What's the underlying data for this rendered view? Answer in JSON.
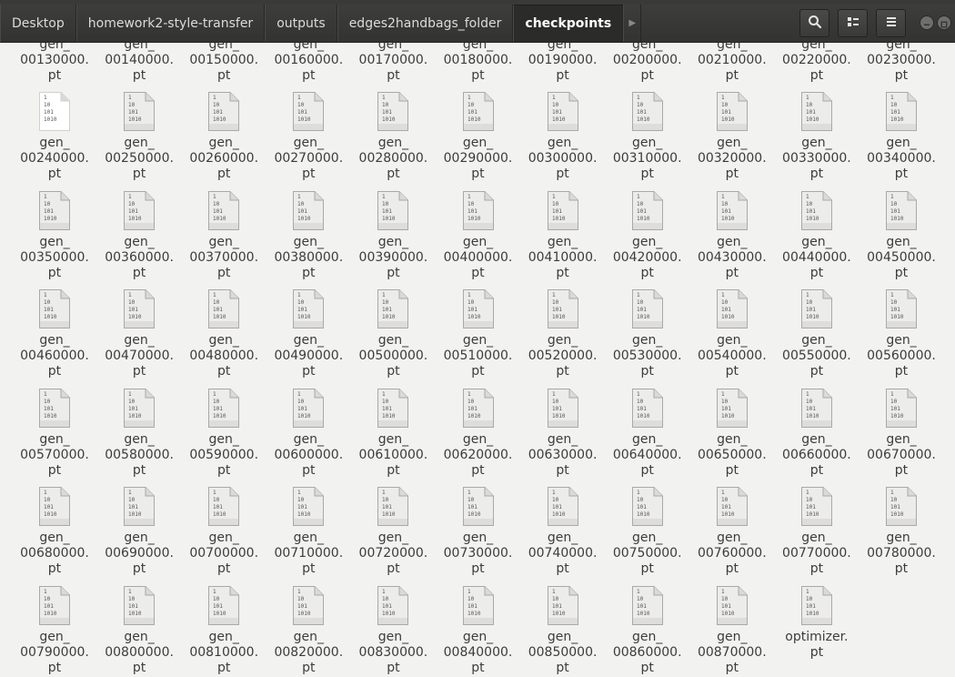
{
  "breadcrumbs": [
    {
      "label": "Desktop",
      "active": false
    },
    {
      "label": "homework2-style-transfer",
      "active": false
    },
    {
      "label": "outputs",
      "active": false
    },
    {
      "label": "edges2handbags_folder",
      "active": false
    },
    {
      "label": "checkpoints",
      "active": true
    }
  ],
  "toolbar": {
    "breadcrumb_scroll_icon": "triangle-right-icon",
    "search_icon": "search-icon",
    "view_icon": "view-options-icon",
    "menu_icon": "hamburger-menu-icon"
  },
  "window_controls": [
    "minimize-icon",
    "maximize-icon"
  ],
  "file_icon": {
    "name": "binary-file-icon",
    "glyph_lines": [
      "1",
      "10",
      "101",
      "1010"
    ]
  },
  "partial_row": [
    {
      "line1": "gen_",
      "line2": "00130000.",
      "line3": "pt"
    },
    {
      "line1": "gen_",
      "line2": "00140000.",
      "line3": "pt"
    },
    {
      "line1": "gen_",
      "line2": "00150000.",
      "line3": "pt"
    },
    {
      "line1": "gen_",
      "line2": "00160000.",
      "line3": "pt"
    },
    {
      "line1": "gen_",
      "line2": "00170000.",
      "line3": "pt"
    },
    {
      "line1": "gen_",
      "line2": "00180000.",
      "line3": "pt"
    },
    {
      "line1": "gen_",
      "line2": "00190000.",
      "line3": "pt"
    },
    {
      "line1": "gen_",
      "line2": "00200000.",
      "line3": "pt"
    },
    {
      "line1": "gen_",
      "line2": "00210000.",
      "line3": "pt"
    },
    {
      "line1": "gen_",
      "line2": "00220000.",
      "line3": "pt"
    },
    {
      "line1": "gen_",
      "line2": "00230000.",
      "line3": "pt"
    }
  ],
  "files": [
    {
      "line1": "gen_",
      "line2": "00240000.",
      "line3": "pt",
      "selected_icon": true
    },
    {
      "line1": "gen_",
      "line2": "00250000.",
      "line3": "pt"
    },
    {
      "line1": "gen_",
      "line2": "00260000.",
      "line3": "pt"
    },
    {
      "line1": "gen_",
      "line2": "00270000.",
      "line3": "pt"
    },
    {
      "line1": "gen_",
      "line2": "00280000.",
      "line3": "pt"
    },
    {
      "line1": "gen_",
      "line2": "00290000.",
      "line3": "pt"
    },
    {
      "line1": "gen_",
      "line2": "00300000.",
      "line3": "pt"
    },
    {
      "line1": "gen_",
      "line2": "00310000.",
      "line3": "pt"
    },
    {
      "line1": "gen_",
      "line2": "00320000.",
      "line3": "pt"
    },
    {
      "line1": "gen_",
      "line2": "00330000.",
      "line3": "pt"
    },
    {
      "line1": "gen_",
      "line2": "00340000.",
      "line3": "pt"
    },
    {
      "line1": "gen_",
      "line2": "00350000.",
      "line3": "pt"
    },
    {
      "line1": "gen_",
      "line2": "00360000.",
      "line3": "pt"
    },
    {
      "line1": "gen_",
      "line2": "00370000.",
      "line3": "pt"
    },
    {
      "line1": "gen_",
      "line2": "00380000.",
      "line3": "pt"
    },
    {
      "line1": "gen_",
      "line2": "00390000.",
      "line3": "pt"
    },
    {
      "line1": "gen_",
      "line2": "00400000.",
      "line3": "pt"
    },
    {
      "line1": "gen_",
      "line2": "00410000.",
      "line3": "pt"
    },
    {
      "line1": "gen_",
      "line2": "00420000.",
      "line3": "pt"
    },
    {
      "line1": "gen_",
      "line2": "00430000.",
      "line3": "pt"
    },
    {
      "line1": "gen_",
      "line2": "00440000.",
      "line3": "pt"
    },
    {
      "line1": "gen_",
      "line2": "00450000.",
      "line3": "pt"
    },
    {
      "line1": "gen_",
      "line2": "00460000.",
      "line3": "pt"
    },
    {
      "line1": "gen_",
      "line2": "00470000.",
      "line3": "pt"
    },
    {
      "line1": "gen_",
      "line2": "00480000.",
      "line3": "pt"
    },
    {
      "line1": "gen_",
      "line2": "00490000.",
      "line3": "pt"
    },
    {
      "line1": "gen_",
      "line2": "00500000.",
      "line3": "pt"
    },
    {
      "line1": "gen_",
      "line2": "00510000.",
      "line3": "pt"
    },
    {
      "line1": "gen_",
      "line2": "00520000.",
      "line3": "pt"
    },
    {
      "line1": "gen_",
      "line2": "00530000.",
      "line3": "pt"
    },
    {
      "line1": "gen_",
      "line2": "00540000.",
      "line3": "pt"
    },
    {
      "line1": "gen_",
      "line2": "00550000.",
      "line3": "pt"
    },
    {
      "line1": "gen_",
      "line2": "00560000.",
      "line3": "pt"
    },
    {
      "line1": "gen_",
      "line2": "00570000.",
      "line3": "pt"
    },
    {
      "line1": "gen_",
      "line2": "00580000.",
      "line3": "pt"
    },
    {
      "line1": "gen_",
      "line2": "00590000.",
      "line3": "pt"
    },
    {
      "line1": "gen_",
      "line2": "00600000.",
      "line3": "pt"
    },
    {
      "line1": "gen_",
      "line2": "00610000.",
      "line3": "pt"
    },
    {
      "line1": "gen_",
      "line2": "00620000.",
      "line3": "pt"
    },
    {
      "line1": "gen_",
      "line2": "00630000.",
      "line3": "pt"
    },
    {
      "line1": "gen_",
      "line2": "00640000.",
      "line3": "pt"
    },
    {
      "line1": "gen_",
      "line2": "00650000.",
      "line3": "pt"
    },
    {
      "line1": "gen_",
      "line2": "00660000.",
      "line3": "pt"
    },
    {
      "line1": "gen_",
      "line2": "00670000.",
      "line3": "pt"
    },
    {
      "line1": "gen_",
      "line2": "00680000.",
      "line3": "pt"
    },
    {
      "line1": "gen_",
      "line2": "00690000.",
      "line3": "pt"
    },
    {
      "line1": "gen_",
      "line2": "00700000.",
      "line3": "pt"
    },
    {
      "line1": "gen_",
      "line2": "00710000.",
      "line3": "pt"
    },
    {
      "line1": "gen_",
      "line2": "00720000.",
      "line3": "pt"
    },
    {
      "line1": "gen_",
      "line2": "00730000.",
      "line3": "pt"
    },
    {
      "line1": "gen_",
      "line2": "00740000.",
      "line3": "pt"
    },
    {
      "line1": "gen_",
      "line2": "00750000.",
      "line3": "pt"
    },
    {
      "line1": "gen_",
      "line2": "00760000.",
      "line3": "pt"
    },
    {
      "line1": "gen_",
      "line2": "00770000.",
      "line3": "pt"
    },
    {
      "line1": "gen_",
      "line2": "00780000.",
      "line3": "pt"
    },
    {
      "line1": "gen_",
      "line2": "00790000.",
      "line3": "pt"
    },
    {
      "line1": "gen_",
      "line2": "00800000.",
      "line3": "pt"
    },
    {
      "line1": "gen_",
      "line2": "00810000.",
      "line3": "pt"
    },
    {
      "line1": "gen_",
      "line2": "00820000.",
      "line3": "pt"
    },
    {
      "line1": "gen_",
      "line2": "00830000.",
      "line3": "pt"
    },
    {
      "line1": "gen_",
      "line2": "00840000.",
      "line3": "pt"
    },
    {
      "line1": "gen_",
      "line2": "00850000.",
      "line3": "pt"
    },
    {
      "line1": "gen_",
      "line2": "00860000.",
      "line3": "pt"
    },
    {
      "line1": "gen_",
      "line2": "00870000.",
      "line3": "pt"
    },
    {
      "line1": "optimizer.",
      "line2": "pt",
      "line3": ""
    }
  ]
}
